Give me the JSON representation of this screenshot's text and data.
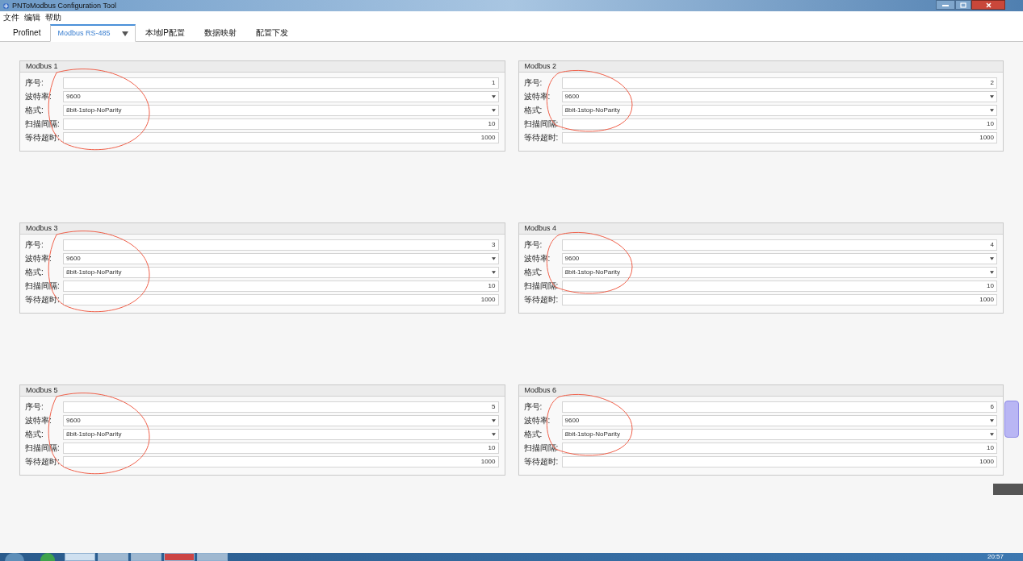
{
  "window": {
    "title": "PNToModbus Configuration Tool"
  },
  "menu": [
    "文件",
    "编辑",
    "帮助"
  ],
  "tabs": [
    {
      "label": "Profinet",
      "selected": false,
      "dropdown": false
    },
    {
      "label": "Modbus RS-485",
      "selected": true,
      "dropdown": true
    },
    {
      "label": "本地IP配置",
      "selected": false,
      "dropdown": false
    },
    {
      "label": "数据映射",
      "selected": false,
      "dropdown": false
    },
    {
      "label": "配置下发",
      "selected": false,
      "dropdown": false
    }
  ],
  "panels": [
    {
      "title": "Modbus 1",
      "circled": true,
      "fields": [
        {
          "label": "序号:",
          "kind": "number",
          "value": "1"
        },
        {
          "label": "波特率:",
          "kind": "select",
          "value": "9600"
        },
        {
          "label": "格式:",
          "kind": "select",
          "value": "8bit-1stop-NoParity"
        },
        {
          "label": "扫描间隔:",
          "kind": "number",
          "value": "10"
        },
        {
          "label": "等待超时:",
          "kind": "number",
          "value": "1000"
        }
      ]
    },
    {
      "title": "Modbus 2",
      "circled": true,
      "fields": [
        {
          "label": "序号:",
          "kind": "number",
          "value": "2"
        },
        {
          "label": "波特率:",
          "kind": "select",
          "value": "9600"
        },
        {
          "label": "格式:",
          "kind": "select",
          "value": "8bit-1stop-NoParity"
        },
        {
          "label": "扫描间隔:",
          "kind": "number",
          "value": "10"
        },
        {
          "label": "等待超时:",
          "kind": "number",
          "value": "1000"
        }
      ]
    },
    {
      "title": "Modbus 3",
      "circled": true,
      "fields": [
        {
          "label": "序号:",
          "kind": "number",
          "value": "3"
        },
        {
          "label": "波特率:",
          "kind": "select",
          "value": "9600"
        },
        {
          "label": "格式:",
          "kind": "select",
          "value": "8bit-1stop-NoParity"
        },
        {
          "label": "扫描间隔:",
          "kind": "number",
          "value": "10"
        },
        {
          "label": "等待超时:",
          "kind": "number",
          "value": "1000"
        }
      ]
    },
    {
      "title": "Modbus 4",
      "circled": true,
      "fields": [
        {
          "label": "序号:",
          "kind": "number",
          "value": "4"
        },
        {
          "label": "波特率:",
          "kind": "select",
          "value": "9600"
        },
        {
          "label": "格式:",
          "kind": "select",
          "value": "8bit-1stop-NoParity"
        },
        {
          "label": "扫描间隔:",
          "kind": "number",
          "value": "10"
        },
        {
          "label": "等待超时:",
          "kind": "number",
          "value": "1000"
        }
      ]
    },
    {
      "title": "Modbus 5",
      "circled": true,
      "fields": [
        {
          "label": "序号:",
          "kind": "number",
          "value": "5"
        },
        {
          "label": "波特率:",
          "kind": "select",
          "value": "9600"
        },
        {
          "label": "格式:",
          "kind": "select",
          "value": "8bit-1stop-NoParity"
        },
        {
          "label": "扫描间隔:",
          "kind": "number",
          "value": "10"
        },
        {
          "label": "等待超时:",
          "kind": "number",
          "value": "1000"
        }
      ]
    },
    {
      "title": "Modbus 6",
      "circled": true,
      "fields": [
        {
          "label": "序号:",
          "kind": "number",
          "value": "6"
        },
        {
          "label": "波特率:",
          "kind": "select",
          "value": "9600"
        },
        {
          "label": "格式:",
          "kind": "select",
          "value": "8bit-1stop-NoParity"
        },
        {
          "label": "扫描间隔:",
          "kind": "number",
          "value": "10"
        },
        {
          "label": "等待超时:",
          "kind": "number",
          "value": "1000"
        }
      ]
    }
  ],
  "taskbar": {
    "clock": "20:57"
  }
}
